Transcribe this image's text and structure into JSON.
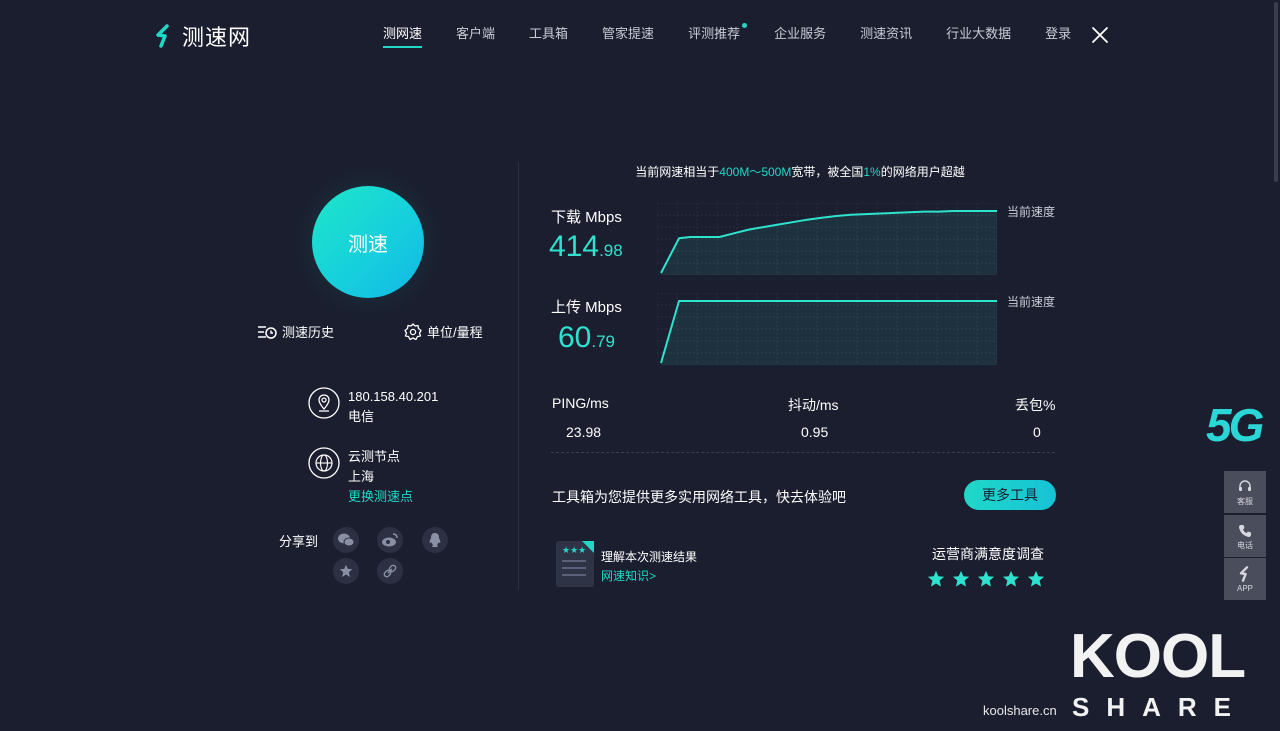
{
  "header": {
    "brand": "测速网",
    "nav": [
      {
        "label": "测网速",
        "active": true
      },
      {
        "label": "客户端"
      },
      {
        "label": "工具箱"
      },
      {
        "label": "管家提速"
      },
      {
        "label": "评测推荐",
        "dot": true
      },
      {
        "label": "企业服务"
      },
      {
        "label": "测速资讯"
      },
      {
        "label": "行业大数据"
      },
      {
        "label": "登录"
      }
    ]
  },
  "left": {
    "speed_button": "测速",
    "history_label": "测速历史",
    "units_label": "单位/量程",
    "ip": "180.158.40.201",
    "isp": "电信",
    "node_title": "云测节点",
    "node_city": "上海",
    "change_node": "更换测速点",
    "share_label": "分享到"
  },
  "summary": {
    "prefix": "当前网速相当于",
    "band": "400M～500M",
    "middle": "宽带，被全国",
    "percent": "1%",
    "suffix": "的网络用户超越"
  },
  "download": {
    "label": "下载 Mbps",
    "int": "414",
    "dec": ".98",
    "current_label": "当前速度"
  },
  "upload": {
    "label": "上传 Mbps",
    "int": "60",
    "dec": ".79",
    "current_label": "当前速度"
  },
  "stats": {
    "ping_label": "PING/ms",
    "ping": "23.98",
    "jitter_label": "抖动/ms",
    "jitter": "0.95",
    "loss_label": "丢包%",
    "loss": "0"
  },
  "tools": {
    "text": "工具箱为您提供更多实用网络工具，快去体验吧",
    "button": "更多工具"
  },
  "knowledge": {
    "title": "理解本次测速结果",
    "link": "网速知识>"
  },
  "survey": {
    "title": "运营商满意度调查",
    "stars": 5
  },
  "float": {
    "badge": "5G",
    "service": "客服",
    "phone": "电话",
    "app": "APP"
  },
  "watermark": {
    "url": "koolshare.cn",
    "kool": "KOOL",
    "share": "SHARE"
  },
  "colors": {
    "background": "#1b1e2e",
    "accent": "#20d8c8",
    "value": "#2de3cf"
  },
  "chart_data": [
    {
      "type": "line",
      "series": [
        {
          "values": [
            0,
            56,
            58,
            58,
            58,
            64,
            70,
            74,
            78,
            82,
            86,
            89,
            92,
            94,
            95,
            96,
            97,
            98,
            99,
            99,
            100,
            100,
            100,
            100
          ]
        }
      ],
      "ylim": [
        0,
        100
      ]
    },
    {
      "type": "line",
      "series": [
        {
          "values": [
            0,
            100,
            100,
            100,
            100,
            100,
            100,
            100,
            100,
            100,
            100,
            100,
            100,
            100,
            100,
            100,
            100,
            100,
            100,
            100,
            100,
            100,
            100,
            100
          ]
        }
      ],
      "ylim": [
        0,
        100
      ]
    }
  ]
}
